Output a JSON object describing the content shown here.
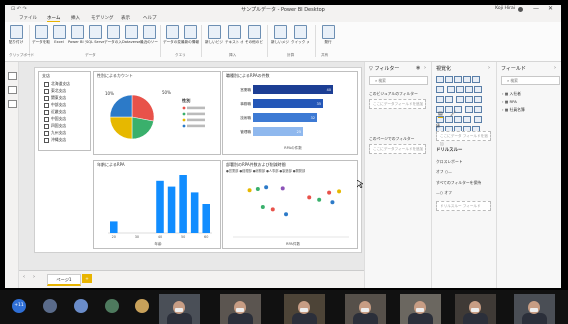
{
  "window": {
    "title": "サンプルデータ - Power BI Desktop",
    "user": "Koji Hirai",
    "minimize": "—",
    "close": "✕"
  },
  "menu": [
    "ファイル",
    "ホーム",
    "挿入",
    "モデリング",
    "表示",
    "ヘルプ"
  ],
  "ribbon": {
    "groups": [
      "クリップボード",
      "データ",
      "クエリ",
      "挿入",
      "計算",
      "共有"
    ],
    "buttons": [
      "貼り付け",
      "データを取得",
      "Excel",
      "Power BI データセット",
      "SQL Server",
      "データの入力",
      "Dataverse",
      "最近のソース",
      "データの変換",
      "最新の情報に更新",
      "新しいビジュアル",
      "テキスト ボックス",
      "その他のビジュアル",
      "新しいメジャー",
      "クイック メジャー",
      "発行"
    ]
  },
  "slicer": {
    "title": "支店",
    "items": [
      "北海道支店",
      "東北支店",
      "関東支店",
      "中部支店",
      "近畿支店",
      "中国支店",
      "四国支店",
      "九州支店",
      "沖縄支店"
    ]
  },
  "pie_tile": {
    "title": "性別によるカウント",
    "label_top": "10%",
    "label_right": "50%",
    "legend_title": "性別",
    "colors": [
      "#e8524a",
      "#3ab06c",
      "#e6b800",
      "#2c7ac8"
    ]
  },
  "bar_tile": {
    "title": "職種別によるRPAの件数",
    "xlabel": "RPAの件数"
  },
  "column_tile": {
    "title": "年齢によるRPA",
    "xlabel": "年齢"
  },
  "scatter_tile": {
    "title": "部署別のRPA件数および削減時間",
    "subtitle": "●営業部 ●経理部 ●総務部 ●人事部 ●製造部 ●開発部",
    "xlabel": "RPA件数"
  },
  "chart_data": [
    {
      "type": "pie",
      "title": "性別によるカウント",
      "slices": [
        {
          "color": "#e8524a",
          "value": 28
        },
        {
          "color": "#3ab06c",
          "value": 22
        },
        {
          "color": "#e6b800",
          "value": 25
        },
        {
          "color": "#2c7ac8",
          "value": 25
        }
      ]
    },
    {
      "type": "bar",
      "orientation": "horizontal",
      "title": "職種別によるRPAの件数",
      "categories": [
        "営業職",
        "事務職",
        "技術職",
        "管理職"
      ],
      "values": [
        40,
        35,
        32,
        25
      ],
      "data_labels": [
        "40",
        "35",
        "32",
        "25"
      ],
      "colors": [
        "#1c3e94",
        "#2457b8",
        "#3d7ad4",
        "#8fb8ee"
      ],
      "xlabel": "RPAの件数",
      "xlim": [
        0,
        45
      ]
    },
    {
      "type": "bar",
      "title": "年齢によるRPA",
      "categories": [
        "20",
        "25",
        "30",
        "35",
        "40",
        "45",
        "50",
        "55",
        "60"
      ],
      "values": [
        2,
        0,
        0,
        0,
        9,
        8,
        10,
        7,
        5
      ],
      "xticks": [
        "20",
        "30",
        "40",
        "50",
        "60"
      ],
      "xlabel": "年齢",
      "ylim": [
        0,
        10
      ]
    },
    {
      "type": "scatter",
      "title": "部署別のRPA件数および削減時間",
      "points": [
        {
          "x": 1.0,
          "y": 7.8,
          "color": "#e6b800"
        },
        {
          "x": 1.5,
          "y": 8.0,
          "color": "#3ab06c"
        },
        {
          "x": 2.0,
          "y": 8.3,
          "color": "#2c7ac8"
        },
        {
          "x": 3.0,
          "y": 8.1,
          "color": "#8c53b8"
        },
        {
          "x": 1.8,
          "y": 5.0,
          "color": "#3ab06c"
        },
        {
          "x": 2.4,
          "y": 4.6,
          "color": "#e8524a"
        },
        {
          "x": 3.2,
          "y": 3.8,
          "color": "#2c7ac8"
        },
        {
          "x": 4.6,
          "y": 6.6,
          "color": "#e8524a"
        },
        {
          "x": 5.2,
          "y": 6.2,
          "color": "#3ab06c"
        },
        {
          "x": 5.8,
          "y": 7.4,
          "color": "#e8524a"
        },
        {
          "x": 6.0,
          "y": 5.8,
          "color": "#2c7ac8"
        },
        {
          "x": 6.4,
          "y": 7.6,
          "color": "#e6b800"
        }
      ],
      "xlabel": "RPA件数",
      "xlim": [
        0,
        7
      ],
      "ylim": [
        0,
        10
      ]
    }
  ],
  "filters_pane": {
    "title": "フィルター",
    "search_placeholder": "検索",
    "visual_filter_label": "このビジュアルのフィルター",
    "add_fields": "ここにデータフィールドを追加",
    "page_filter_label": "このページでのフィルター"
  },
  "viz_pane": {
    "title": "視覚化",
    "values_label": "値",
    "values_well": "ここにデータ フィールドを追加",
    "drill_label": "ドリルスルー",
    "cross_report": "クロスレポート",
    "keep_all": "すべてのフィルターを保持",
    "toggle_off": "オフ",
    "drill_well": "ドリルスルー フィールド"
  },
  "fields_pane": {
    "title": "フィールド",
    "search_placeholder": "検索",
    "tables": [
      "入社者",
      "RPA",
      "社員名簿"
    ]
  },
  "page_tabs": {
    "current": "ページ1",
    "add": "+"
  },
  "meeting": {
    "participant_count": "+11"
  }
}
